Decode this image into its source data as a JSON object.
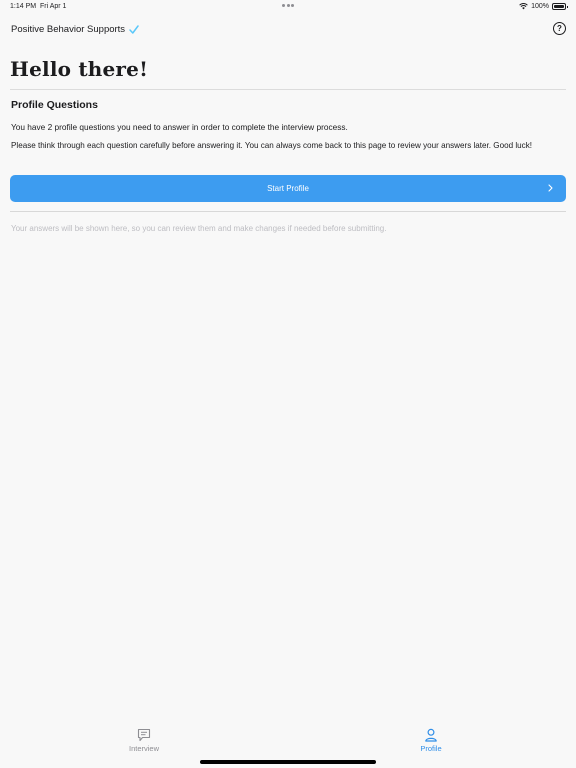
{
  "status_bar": {
    "time": "1:14 PM",
    "date": "Fri Apr 1",
    "battery": "100%"
  },
  "nav": {
    "title": "Positive Behavior Supports",
    "verified_icon": "check-icon",
    "help_icon": "question-circle-icon",
    "help_label": "?"
  },
  "main": {
    "greeting": "Hello there!",
    "section_title": "Profile Questions",
    "intro": "You have 2 profile questions you need to answer in order to complete the interview process.",
    "instructions": "Please think through each question carefully before answering it. You can always come back to this page to review your answers later. Good luck!",
    "start_button": "Start Profile",
    "answers_note": "Your answers will be shown here, so you can review them and make changes if needed before submitting."
  },
  "tabs": [
    {
      "label": "Interview",
      "icon": "chat-bubble-icon",
      "selected": false
    },
    {
      "label": "Profile",
      "icon": "person-icon",
      "selected": true
    }
  ],
  "colors": {
    "accent": "#3d9cf0",
    "tab_selected": "#2f8ee8",
    "tab_unselected": "#8e8e93",
    "background": "#f8f8f8"
  }
}
